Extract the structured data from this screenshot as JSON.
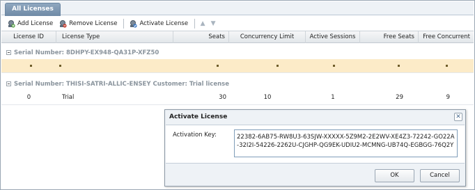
{
  "tab": {
    "label": "All Licenses"
  },
  "toolbar": {
    "add_label": "Add License",
    "remove_label": "Remove License",
    "activate_label": "Activate License",
    "up_icon": "arrow-up-icon",
    "down_icon": "arrow-down-icon"
  },
  "columns": [
    "License ID",
    "License Type",
    "Seats",
    "Concurrency Limit",
    "Active Sessions",
    "Free Seats",
    "Free Concurrent"
  ],
  "groups": [
    {
      "label": "Serial Number: 8DHPY-EX948-QA31P-XFZ50",
      "rows": [
        {
          "cells": [
            "▪",
            "▪",
            "▪",
            "▪",
            "▪",
            "▪",
            "▪"
          ],
          "selected": true
        }
      ]
    },
    {
      "label": "Serial Number: THISI-SATRI-ALLIC-ENSEY   Customer: Trial license",
      "rows": [
        {
          "cells": [
            "0",
            "Trial",
            "30",
            "10",
            "1",
            "29",
            "9"
          ],
          "selected": false
        }
      ]
    }
  ],
  "dialog": {
    "title": "Activate License",
    "key_label": "Activation Key:",
    "key_value": "22382-6AB75-RW8U3-63SJW-XXXXX-5Z9M2-2E2WV-XE4Z3-72242-GO22A-32I2I-54226-2262U-CJGHP-QG9EK-UDIU2-MCMNG-UB74Q-EGBGG-76Q2Y",
    "ok_label": "OK",
    "cancel_label": "Cancel",
    "close_icon": "close-icon"
  },
  "colors": {
    "selected_row": "#fcebc8",
    "accent": "#6f8aa6"
  }
}
